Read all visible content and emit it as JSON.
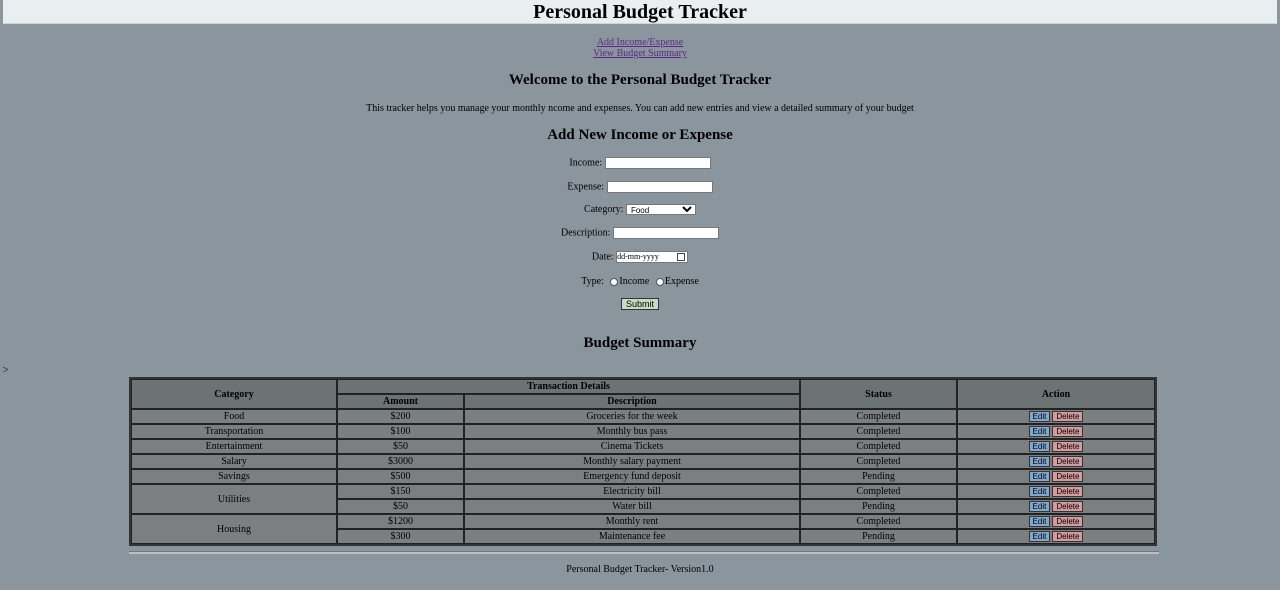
{
  "header": {
    "title": "Personal Budget Tracker"
  },
  "nav": {
    "add_link": "Add Income/Expense",
    "summary_link": "View Budget Summary"
  },
  "welcome": {
    "heading": "Welcome to the Personal Budget Tracker",
    "text": "This tracker helps you manage your monthly ncome and expenses. You can add new entries and view a detailed summary of your budget"
  },
  "form": {
    "title": "Add New Income or Expense",
    "income_label": "Income:",
    "expense_label": "Expense:",
    "category_label": "Category:",
    "category_value": "Food",
    "description_label": "Description:",
    "date_label": "Date:",
    "date_placeholder": "dd-mm-yyyy",
    "type_label": "Type:",
    "type_income": "Income",
    "type_expense": "Expense",
    "submit_label": "Submit"
  },
  "summary": {
    "title": "Budget Summary",
    "stray_text": ">",
    "headers": {
      "category": "Category",
      "transaction_details": "Transaction Details",
      "amount": "Amount",
      "description": "Description",
      "status": "Status",
      "action": "Action"
    },
    "edit_label": "Edit",
    "delete_label": "Delete",
    "rows": [
      {
        "category": "Food",
        "amount": "$200",
        "description": "Groceries for the week",
        "status": "Completed"
      },
      {
        "category": "Transportation",
        "amount": "$100",
        "description": "Monthly bus pass",
        "status": "Completed"
      },
      {
        "category": "Entertainment",
        "amount": "$50",
        "description": "Cinema Tickets",
        "status": "Completed"
      },
      {
        "category": "Salary",
        "amount": "$3000",
        "description": "Monthly salary payment",
        "status": "Completed"
      },
      {
        "category": "Savings",
        "amount": "$500",
        "description": "Emergency fund deposit",
        "status": "Pending"
      },
      {
        "category": "Utilities",
        "amount": "$150",
        "description": "Electricity bill",
        "status": "Completed"
      },
      {
        "category": "",
        "amount": "$50",
        "description": "Water bill",
        "status": "Pending"
      },
      {
        "category": "Housing",
        "amount": "$1200",
        "description": "Monthly rent",
        "status": "Completed"
      },
      {
        "category": "",
        "amount": "$300",
        "description": "Maintenance fee",
        "status": "Pending"
      }
    ]
  },
  "footer": {
    "text": "Personal Budget Tracker- Version1.0"
  }
}
